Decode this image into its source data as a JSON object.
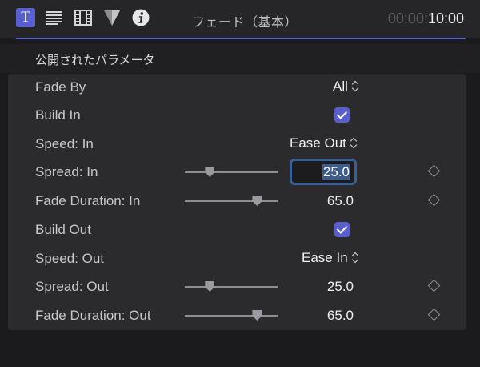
{
  "toolbar": {
    "title": "フェード（基本）",
    "timecode_dim": "00:00:",
    "timecode_main": "10:00",
    "active_accent": "#5a5fd0",
    "icons": [
      "text-inspector-icon",
      "paragraph-icon",
      "film-icon",
      "shape-icon",
      "info-icon"
    ],
    "text_icon_glyph": "T"
  },
  "section": {
    "title": "公開されたパラメータ"
  },
  "params": [
    {
      "label": "Fade By",
      "control": "popup",
      "value": "All"
    },
    {
      "label": "Build In",
      "control": "checkbox",
      "checked": true
    },
    {
      "label": "Speed: In",
      "control": "popup",
      "value": "Ease Out"
    },
    {
      "label": "Spread: In",
      "control": "slider",
      "value": "25.0",
      "slider_fraction": 0.27,
      "editing": true
    },
    {
      "label": "Fade Duration: In",
      "control": "slider",
      "value": "65.0",
      "slider_fraction": 0.78
    },
    {
      "label": "Build Out",
      "control": "checkbox",
      "checked": true
    },
    {
      "label": "Speed: Out",
      "control": "popup",
      "value": "Ease In"
    },
    {
      "label": "Spread: Out",
      "control": "slider",
      "value": "25.0",
      "slider_fraction": 0.27
    },
    {
      "label": "Fade Duration: Out",
      "control": "slider",
      "value": "65.0",
      "slider_fraction": 0.78
    }
  ]
}
